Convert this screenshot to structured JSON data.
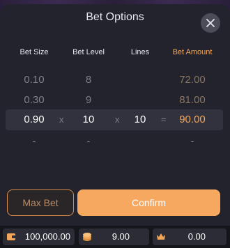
{
  "dialog": {
    "title": "Bet Options"
  },
  "columns": {
    "bet_size": "Bet Size",
    "bet_level": "Bet Level",
    "lines": "Lines",
    "bet_amount": "Bet Amount"
  },
  "rows": [
    {
      "bet_size": "0.10",
      "bet_level": "8",
      "lines": "",
      "bet_amount": "72.00"
    },
    {
      "bet_size": "0.30",
      "bet_level": "9",
      "lines": "",
      "bet_amount": "81.00"
    },
    {
      "bet_size": "0.90",
      "bet_level": "10",
      "lines": "10",
      "bet_amount": "90.00"
    },
    {
      "bet_size": "-",
      "bet_level": "-",
      "lines": "",
      "bet_amount": "-"
    }
  ],
  "operators": {
    "times": "x",
    "equals": "="
  },
  "buttons": {
    "max_bet": "Max Bet",
    "confirm": "Confirm"
  },
  "footer": {
    "balance": "100,000.00",
    "bet": "9.00",
    "win": "0.00"
  },
  "colors": {
    "accent": "#f6a860",
    "amount_text": "#f2a65a",
    "panel": "#22232d"
  },
  "icons": {
    "close": "close-icon",
    "wallet": "wallet-icon",
    "coins": "coins-icon",
    "win": "win-icon"
  }
}
